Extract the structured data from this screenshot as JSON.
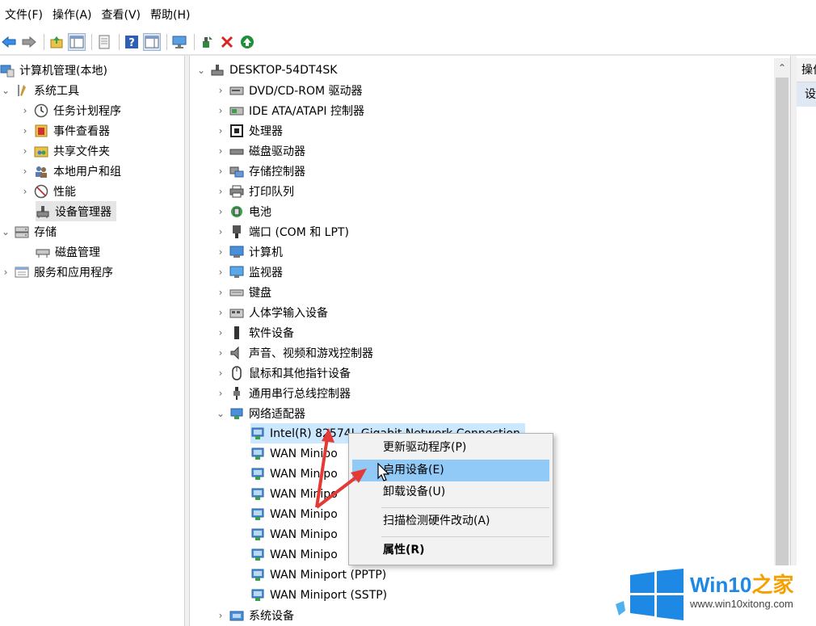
{
  "menu": [
    "文件(F)",
    "操作(A)",
    "查看(V)",
    "帮助(H)"
  ],
  "toolbar_icons": [
    "back-icon",
    "forward-icon",
    "up-folder-icon",
    "show-hide-tree-icon",
    "export-icon",
    "help-icon",
    "view-icon",
    "monitor-icon",
    "update-driver-icon",
    "uninstall-icon",
    "enable-icon"
  ],
  "left_tree": {
    "root": "计算机管理(本地)",
    "system_tools": "系统工具",
    "task_scheduler": "任务计划程序",
    "event_viewer": "事件查看器",
    "shared_folders": "共享文件夹",
    "local_users": "本地用户和组",
    "performance": "性能",
    "device_manager": "设备管理器",
    "storage": "存储",
    "disk_management": "磁盘管理",
    "services_apps": "服务和应用程序"
  },
  "device_tree": {
    "computer": "DESKTOP-54DT4SK",
    "categories": [
      "DVD/CD-ROM 驱动器",
      "IDE ATA/ATAPI 控制器",
      "处理器",
      "磁盘驱动器",
      "存储控制器",
      "打印队列",
      "电池",
      "端口 (COM 和 LPT)",
      "计算机",
      "监视器",
      "键盘",
      "人体学输入设备",
      "软件设备",
      "声音、视频和游戏控制器",
      "鼠标和其他指针设备",
      "通用串行总线控制器",
      "网络适配器"
    ],
    "network_adapters": [
      "Intel(R) 82574L Gigabit Network Connection",
      "WAN Minipo",
      "WAN Minipo",
      "WAN Minipo",
      "WAN Minipo",
      "WAN Minipo",
      "WAN Minipo",
      "WAN Miniport (PPTP)",
      "WAN Miniport (SSTP)"
    ],
    "after": "系统设备"
  },
  "right_pane": {
    "header": "操作",
    "sub": "设备管理器"
  },
  "context_menu": {
    "update_driver": "更新驱动程序(P)",
    "enable_device": "启用设备(E)",
    "uninstall_device": "卸载设备(U)",
    "scan_changes": "扫描检测硬件改动(A)",
    "properties": "属性(R)"
  },
  "watermark": {
    "title_en": "Win10",
    "title_cn": "之家",
    "url": "www.win10xitong.com"
  },
  "colors": {
    "accent": "#1e88e5",
    "highlight": "#91c9f7",
    "selection": "#cce8ff",
    "red_arrow": "#e53935"
  }
}
